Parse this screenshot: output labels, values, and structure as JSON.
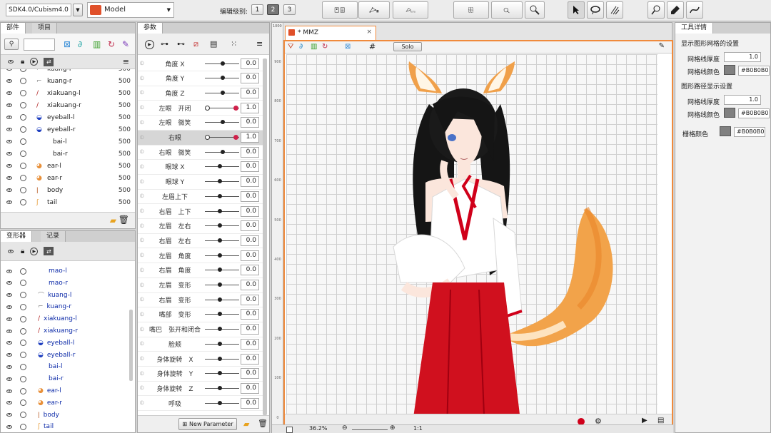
{
  "toolbar": {
    "sdk_select": "SDK4.0/Cubism4.0",
    "mode_select": "Model",
    "edit_level_label": "编辑级别:",
    "edit_levels": [
      "1",
      "2",
      "3"
    ],
    "active_level": "2"
  },
  "parts_panel": {
    "tabs": [
      "部件",
      "项目"
    ],
    "items": [
      {
        "name": "kuang-l",
        "value": "500"
      },
      {
        "name": "kuang-r",
        "value": "500"
      },
      {
        "name": "xiakuang-l",
        "value": "500"
      },
      {
        "name": "xiakuang-r",
        "value": "500"
      },
      {
        "name": "eyeball-l",
        "value": "500"
      },
      {
        "name": "eyeball-r",
        "value": "500"
      },
      {
        "name": "bai-l",
        "value": "500"
      },
      {
        "name": "bai-r",
        "value": "500"
      },
      {
        "name": "ear-l",
        "value": "500"
      },
      {
        "name": "ear-r",
        "value": "500"
      },
      {
        "name": "body",
        "value": "500"
      },
      {
        "name": "tail",
        "value": "500"
      }
    ]
  },
  "deformer_panel": {
    "tabs": [
      "变形器",
      "记录"
    ],
    "items": [
      "mao-l",
      "mao-r",
      "kuang-l",
      "kuang-r",
      "xiakuang-l",
      "xiakuang-r",
      "eyeball-l",
      "eyeball-r",
      "bai-l",
      "bai-r",
      "ear-l",
      "ear-r",
      "body",
      "tail"
    ]
  },
  "params_panel": {
    "tab": "参数",
    "new_parameter_label": "New Parameter",
    "params": [
      {
        "label": "角度 X",
        "value": "0.0"
      },
      {
        "label": "角度 Y",
        "value": "0.0"
      },
      {
        "label": "角度 Z",
        "value": "0.0"
      },
      {
        "label": "左眼　开闭",
        "value": "1.0"
      },
      {
        "label": "左眼　微笑",
        "value": "0.0"
      },
      {
        "label": "右眼",
        "value": "1.0"
      },
      {
        "label": "右眼　微笑",
        "value": "0.0"
      },
      {
        "label": "眼球 X",
        "value": "0.0"
      },
      {
        "label": "眼球 Y",
        "value": "0.0"
      },
      {
        "label": "左眉上下",
        "value": "0.0"
      },
      {
        "label": "右眉　上下",
        "value": "0.0"
      },
      {
        "label": "左眉　左右",
        "value": "0.0"
      },
      {
        "label": "右眉　左右",
        "value": "0.0"
      },
      {
        "label": "左眉　角度",
        "value": "0.0"
      },
      {
        "label": "右眉　角度",
        "value": "0.0"
      },
      {
        "label": "左眉　变形",
        "value": "0.0"
      },
      {
        "label": "右眉　变形",
        "value": "0.0"
      },
      {
        "label": "嘴部　变形",
        "value": "0.0"
      },
      {
        "label": "嘴巴　张开和闭合",
        "value": "0.0"
      },
      {
        "label": "脸颊",
        "value": "0.0"
      },
      {
        "label": "身体旋转　X",
        "value": "0.0"
      },
      {
        "label": "身体旋转　Y",
        "value": "0.0"
      },
      {
        "label": "身体旋转　Z",
        "value": "0.0"
      },
      {
        "label": "呼吸",
        "value": "0.0"
      }
    ]
  },
  "viewport": {
    "tab_title": "* MMZ",
    "solo_label": "Solo",
    "zoom": "36.2%",
    "ruler_top": "1000",
    "ruler_ticks": [
      "900",
      "800",
      "700",
      "600",
      "500",
      "400",
      "300",
      "200",
      "100",
      "0"
    ],
    "page_label": "1:1"
  },
  "inspector": {
    "title": "工具详情",
    "section1": "显示图形网格的设置",
    "mesh_thickness_label": "网格线厚度",
    "mesh_thickness_value": "1.0",
    "mesh_color_label": "网格线颜色",
    "mesh_color_value": "#B0B0B0",
    "section2": "图形路径显示设置",
    "path_thickness_label": "网格线厚度",
    "path_thickness_value": "1.0",
    "path_color_label": "网格线颜色",
    "path_color_value": "#B0B0B0",
    "grid_color_label": "栅格颜色",
    "grid_color_value": "#B0B0B0"
  },
  "colors": {
    "accent_orange": "#f08a3c",
    "selection_blue": "#bcd2f2",
    "deformer_text": "#0c2aa8",
    "record_red": "#d0001a"
  }
}
